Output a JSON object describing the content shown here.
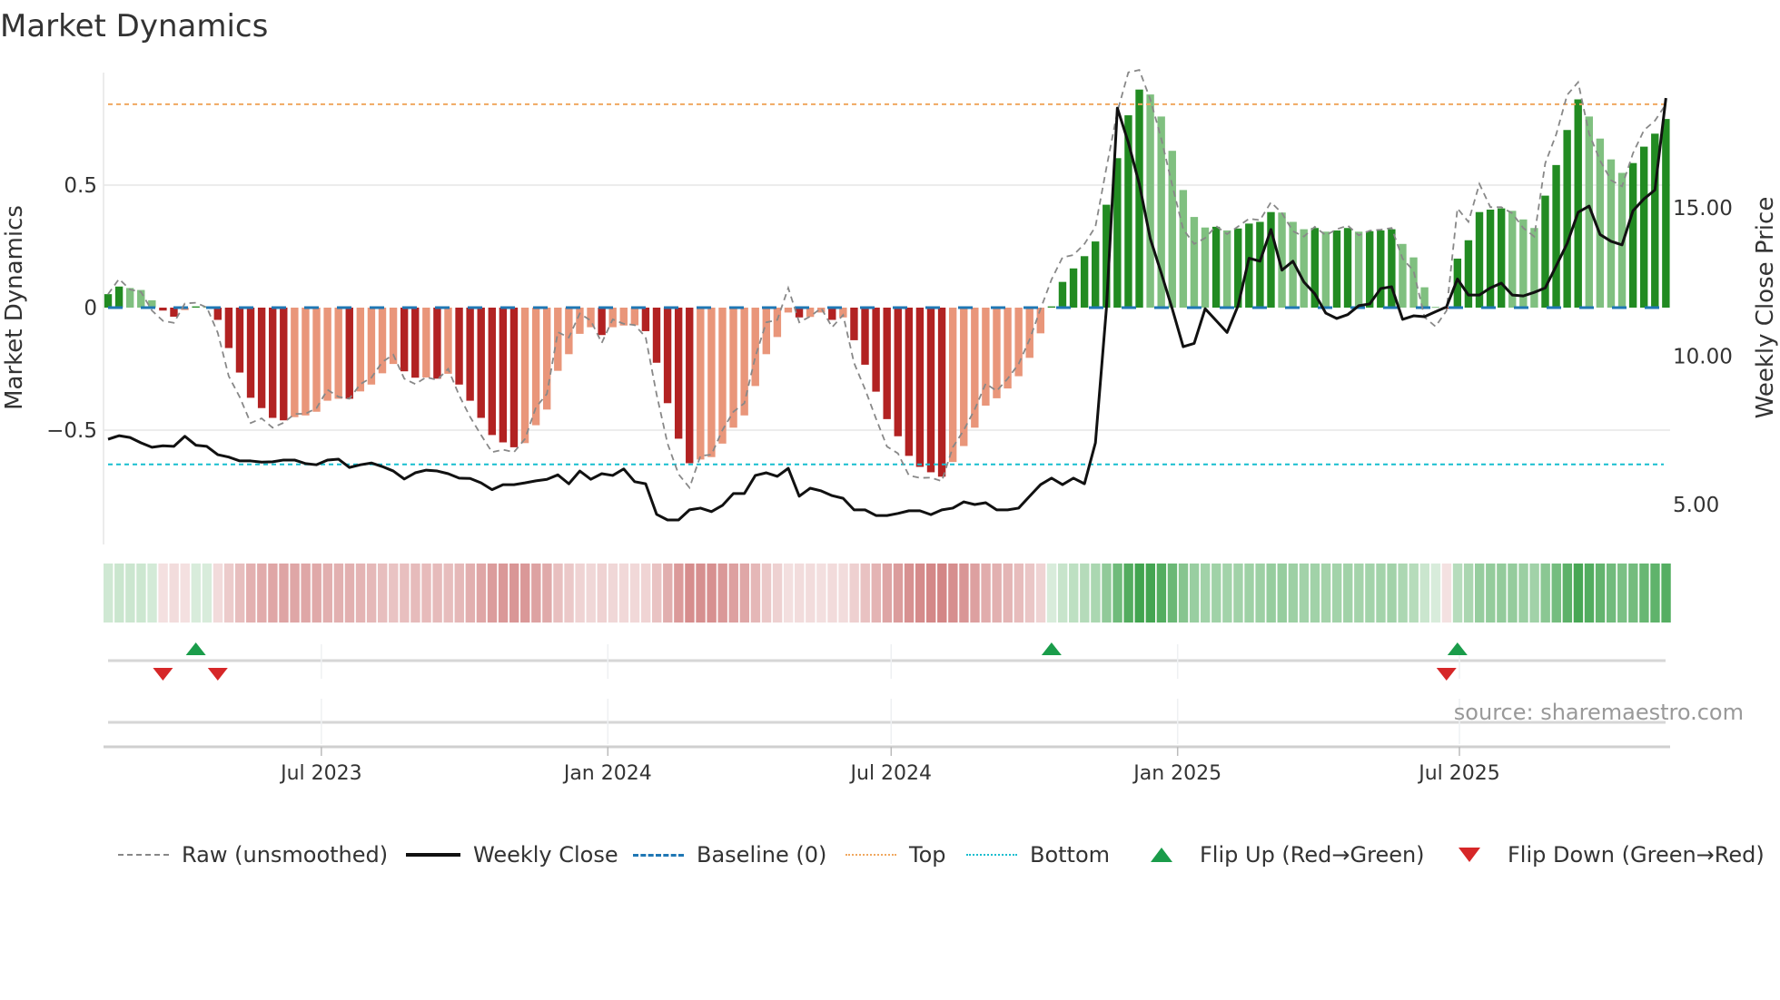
{
  "colors": {
    "dark_green": "#228b22",
    "light_green": "#80c080",
    "dark_red": "#b22222",
    "salmon": "#e9967a",
    "strip_green": "#3fa34d",
    "strip_red": "#c96a6a",
    "raw": "#888888",
    "close": "#111111",
    "baseline": "#1f77b4",
    "top": "#f0a860",
    "bottom": "#17becf",
    "flip_up": "#1a9c4a",
    "flip_down": "#d62728"
  },
  "chart_data": {
    "type": "bar",
    "title": "Market Dynamics",
    "ylabel": "Market Dynamics",
    "y2label": "Weekly Close Price",
    "ylim": [
      -0.88,
      1.0
    ],
    "y2lim": [
      3.9,
      19.8
    ],
    "yticks": [
      {
        "value": 0.5,
        "label": "0.5"
      },
      {
        "value": 0,
        "label": "0"
      },
      {
        "value": -0.5,
        "label": "−0.5"
      }
    ],
    "y2ticks": [
      {
        "value": 15,
        "label": "15.00"
      },
      {
        "value": 10,
        "label": "10.00"
      },
      {
        "value": 5,
        "label": "5.00"
      }
    ],
    "x_start": "2023-02-14",
    "x_step_days": 7,
    "xticks": [
      {
        "date": "2023-07-01",
        "label": "Jul 2023"
      },
      {
        "date": "2024-01-01",
        "label": "Jan 2024"
      },
      {
        "date": "2024-07-01",
        "label": "Jul 2024"
      },
      {
        "date": "2025-01-01",
        "label": "Jan 2025"
      },
      {
        "date": "2025-07-01",
        "label": "Jul 2025"
      }
    ],
    "top_level": 0.83,
    "bottom_level": -0.64,
    "baseline": 0,
    "series": [
      {
        "name": "Market Dynamics (smoothed)",
        "values": [
          0.055,
          0.086,
          0.08,
          0.072,
          0.03,
          -0.012,
          -0.037,
          -0.01,
          0.005,
          0.003,
          -0.05,
          -0.165,
          -0.265,
          -0.368,
          -0.41,
          -0.45,
          -0.46,
          -0.447,
          -0.44,
          -0.425,
          -0.38,
          -0.372,
          -0.372,
          -0.342,
          -0.314,
          -0.268,
          -0.23,
          -0.26,
          -0.286,
          -0.285,
          -0.29,
          -0.27,
          -0.314,
          -0.38,
          -0.45,
          -0.52,
          -0.55,
          -0.57,
          -0.553,
          -0.48,
          -0.416,
          -0.258,
          -0.19,
          -0.107,
          -0.08,
          -0.112,
          -0.08,
          -0.073,
          -0.072,
          -0.096,
          -0.225,
          -0.39,
          -0.535,
          -0.635,
          -0.62,
          -0.61,
          -0.555,
          -0.49,
          -0.44,
          -0.32,
          -0.19,
          -0.12,
          -0.02,
          -0.04,
          -0.038,
          -0.02,
          -0.05,
          -0.04,
          -0.133,
          -0.233,
          -0.343,
          -0.455,
          -0.525,
          -0.605,
          -0.65,
          -0.672,
          -0.69,
          -0.63,
          -0.565,
          -0.49,
          -0.4,
          -0.37,
          -0.33,
          -0.28,
          -0.205,
          -0.105,
          0.005,
          0.105,
          0.16,
          0.21,
          0.27,
          0.42,
          0.61,
          0.785,
          0.89,
          0.87,
          0.78,
          0.64,
          0.48,
          0.37,
          0.327,
          0.33,
          0.315,
          0.323,
          0.343,
          0.35,
          0.39,
          0.388,
          0.35,
          0.32,
          0.325,
          0.31,
          0.315,
          0.325,
          0.31,
          0.312,
          0.315,
          0.32,
          0.26,
          0.205,
          0.083,
          0.003,
          -0.005,
          0.2,
          0.275,
          0.39,
          0.4,
          0.405,
          0.395,
          0.36,
          0.325,
          0.457,
          0.582,
          0.725,
          0.85,
          0.78,
          0.69,
          0.605,
          0.55,
          0.59,
          0.657,
          0.71,
          0.77
        ]
      },
      {
        "name": "Raw (unsmoothed)",
        "values": [
          0.055,
          0.117,
          0.074,
          0.064,
          -0.012,
          -0.054,
          -0.062,
          0.017,
          0.02,
          0.001,
          -0.103,
          -0.28,
          -0.365,
          -0.471,
          -0.452,
          -0.49,
          -0.47,
          -0.434,
          -0.433,
          -0.41,
          -0.335,
          -0.364,
          -0.372,
          -0.312,
          -0.286,
          -0.222,
          -0.192,
          -0.29,
          -0.312,
          -0.284,
          -0.295,
          -0.25,
          -0.358,
          -0.446,
          -0.52,
          -0.59,
          -0.58,
          -0.59,
          -0.536,
          -0.407,
          -0.352,
          -0.1,
          -0.122,
          -0.024,
          -0.053,
          -0.144,
          -0.048,
          -0.066,
          -0.071,
          -0.12,
          -0.354,
          -0.555,
          -0.68,
          -0.735,
          -0.605,
          -0.6,
          -0.5,
          -0.425,
          -0.39,
          -0.2,
          -0.06,
          -0.05,
          0.08,
          -0.06,
          -0.036,
          -0.002,
          -0.08,
          -0.03,
          -0.226,
          -0.333,
          -0.453,
          -0.567,
          -0.595,
          -0.685,
          -0.695,
          -0.694,
          -0.708,
          -0.57,
          -0.5,
          -0.415,
          -0.31,
          -0.34,
          -0.29,
          -0.23,
          -0.13,
          -0.005,
          0.115,
          0.205,
          0.215,
          0.26,
          0.33,
          0.57,
          0.8,
          0.96,
          0.97,
          0.85,
          0.69,
          0.5,
          0.32,
          0.26,
          0.284,
          0.333,
          0.3,
          0.331,
          0.363,
          0.357,
          0.43,
          0.386,
          0.312,
          0.29,
          0.33,
          0.295,
          0.32,
          0.335,
          0.295,
          0.314,
          0.318,
          0.325,
          0.2,
          0.15,
          -0.039,
          -0.077,
          -0.013,
          0.405,
          0.35,
          0.505,
          0.41,
          0.41,
          0.385,
          0.325,
          0.29,
          0.589,
          0.707,
          0.868,
          0.92,
          0.71,
          0.6,
          0.52,
          0.495,
          0.63,
          0.724,
          0.763,
          0.83
        ]
      },
      {
        "name": "Weekly Close",
        "axis": "right",
        "values": [
          7.2,
          7.32,
          7.26,
          7.08,
          6.93,
          6.98,
          6.96,
          7.3,
          7.0,
          6.96,
          6.68,
          6.6,
          6.47,
          6.47,
          6.43,
          6.44,
          6.5,
          6.5,
          6.38,
          6.34,
          6.5,
          6.53,
          6.25,
          6.34,
          6.4,
          6.28,
          6.13,
          5.86,
          6.07,
          6.16,
          6.13,
          6.04,
          5.89,
          5.88,
          5.73,
          5.5,
          5.67,
          5.67,
          5.73,
          5.8,
          5.85,
          6.0,
          5.7,
          6.13,
          5.85,
          6.04,
          5.98,
          6.2,
          5.77,
          5.7,
          4.67,
          4.48,
          4.48,
          4.82,
          4.88,
          4.76,
          4.97,
          5.37,
          5.37,
          5.98,
          6.07,
          5.95,
          6.22,
          5.28,
          5.55,
          5.46,
          5.3,
          5.21,
          4.82,
          4.82,
          4.63,
          4.63,
          4.7,
          4.79,
          4.79,
          4.66,
          4.82,
          4.88,
          5.09,
          5.0,
          5.06,
          4.82,
          4.82,
          4.88,
          5.28,
          5.67,
          5.89,
          5.67,
          5.89,
          5.7,
          7.08,
          11.6,
          18.36,
          17.2,
          15.8,
          13.96,
          12.8,
          11.6,
          10.32,
          10.43,
          11.6,
          11.2,
          10.8,
          11.7,
          13.3,
          13.2,
          14.27,
          12.9,
          13.2,
          12.5,
          12.1,
          11.45,
          11.27,
          11.4,
          11.7,
          11.76,
          12.28,
          12.34,
          11.24,
          11.36,
          11.33,
          11.5,
          11.66,
          12.6,
          12.06,
          12.06,
          12.3,
          12.46,
          12.06,
          12.03,
          12.15,
          12.3,
          13.04,
          13.8,
          14.85,
          15.06,
          14.1,
          13.87,
          13.75,
          14.9,
          15.3,
          15.6,
          18.7
        ]
      }
    ],
    "legend": [
      {
        "key": "raw",
        "label": "Raw (unsmoothed)"
      },
      {
        "key": "close",
        "label": "Weekly Close"
      },
      {
        "key": "baseline",
        "label": "Baseline (0)"
      },
      {
        "key": "top",
        "label": "Top"
      },
      {
        "key": "bottom",
        "label": "Bottom"
      },
      {
        "key": "flip_up",
        "label": "Flip Up (Red→Green)"
      },
      {
        "key": "flip_down",
        "label": "Flip Down (Green→Red)"
      }
    ],
    "legend_position": "bottom",
    "grid": true
  },
  "source_note": "source: sharemaestro.com"
}
